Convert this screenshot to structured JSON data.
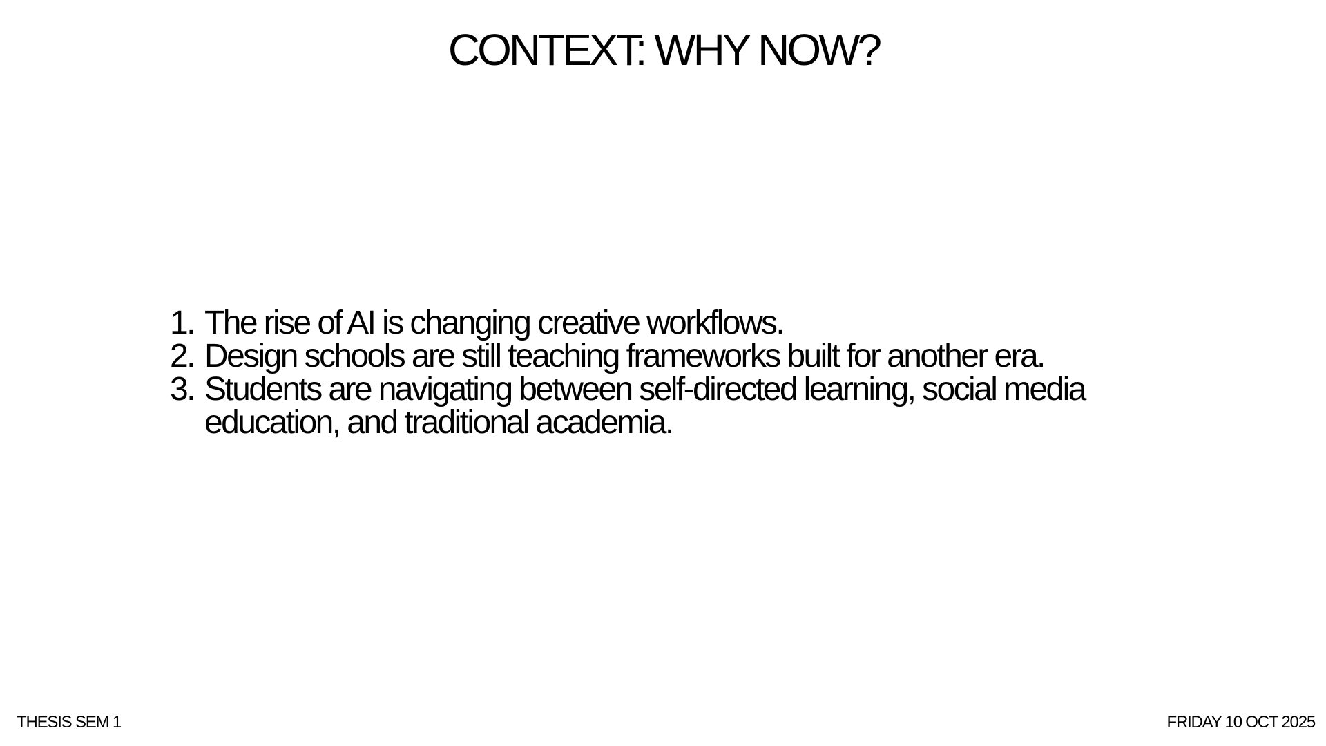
{
  "slide": {
    "title": "CONTEXT: WHY NOW?",
    "points": [
      {
        "number": "1.",
        "text": "The rise of AI is changing creative workflows."
      },
      {
        "number": "2.",
        "text": "Design schools are still teaching frameworks built for another era."
      },
      {
        "number": "3.",
        "text": "Students are navigating between self-directed learning, social media education, and traditional academia."
      }
    ]
  },
  "footer": {
    "left": "THESIS SEM 1",
    "right": "FRIDAY 10 OCT 2025"
  },
  "colors": {
    "background": "#ffffff",
    "text": "#000000"
  }
}
